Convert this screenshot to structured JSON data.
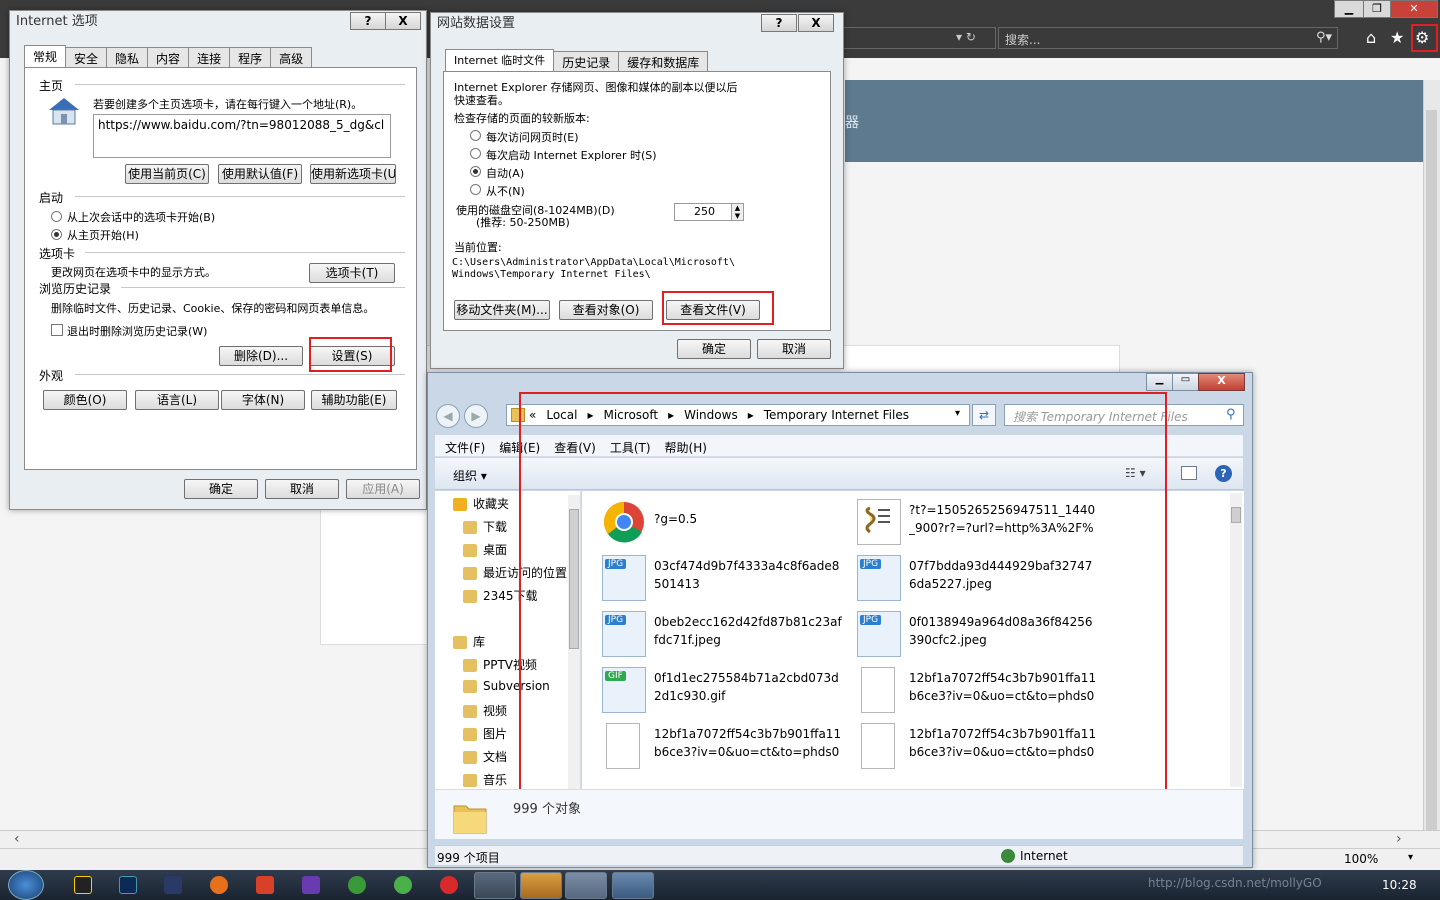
{
  "ie": {
    "search_placeholder": "搜索...",
    "banner_text": "器",
    "zoom": "100%",
    "clock": "10:28",
    "watermark": "http://blog.csdn.net/mollyGO",
    "accent_red": "#e02020"
  },
  "internet_options": {
    "title": "Internet 选项",
    "help": "?",
    "close": "X",
    "tabs": [
      "常规",
      "安全",
      "隐私",
      "内容",
      "连接",
      "程序",
      "高级"
    ],
    "homepage_section": "主页",
    "homepage_hint": "若要创建多个主页选项卡，请在每行键入一个地址(R)。",
    "homepage_url": "https://www.baidu.com/?tn=98012088_5_dg&cl",
    "btn_current": "使用当前页(C)",
    "btn_default": "使用默认值(F)",
    "btn_newtab": "使用新选项卡(U)",
    "startup_section": "启动",
    "startup_opt1": "从上次会话中的选项卡开始(B)",
    "startup_opt2": "从主页开始(H)",
    "tabs_section": "选项卡",
    "tabs_hint": "更改网页在选项卡中的显示方式。",
    "btn_tabs": "选项卡(T)",
    "history_section": "浏览历史记录",
    "history_hint": "删除临时文件、历史记录、Cookie、保存的密码和网页表单信息。",
    "history_check": "退出时删除浏览历史记录(W)",
    "btn_delete": "删除(D)...",
    "btn_settings": "设置(S)",
    "appearance_section": "外观",
    "btn_colors": "颜色(O)",
    "btn_languages": "语言(L)",
    "btn_fonts": "字体(N)",
    "btn_access": "辅助功能(E)",
    "btn_ok": "确定",
    "btn_cancel": "取消",
    "btn_apply": "应用(A)"
  },
  "site_data": {
    "title": "网站数据设置",
    "help": "?",
    "close": "X",
    "tabs": [
      "Internet 临时文件",
      "历史记录",
      "缓存和数据库"
    ],
    "desc1": "Internet Explorer 存储网页、图像和媒体的副本以便以后",
    "desc2": "快速查看。",
    "check_label": "检查存储的页面的较新版本:",
    "opt1": "每次访问网页时(E)",
    "opt2": "每次启动 Internet Explorer 时(S)",
    "opt3": "自动(A)",
    "opt4": "从不(N)",
    "disk_label": "使用的磁盘空间(8-1024MB)(D)",
    "disk_recommend": "(推荐: 50-250MB)",
    "disk_value": "250",
    "location_label": "当前位置:",
    "location_path1": "C:\\Users\\Administrator\\AppData\\Local\\Microsoft\\",
    "location_path2": "Windows\\Temporary Internet Files\\",
    "btn_move": "移动文件夹(M)...",
    "btn_objects": "查看对象(O)",
    "btn_files": "查看文件(V)",
    "btn_ok": "确定",
    "btn_cancel": "取消"
  },
  "explorer": {
    "breadcrumb": [
      "«",
      "Local",
      "Microsoft",
      "Windows",
      "Temporary Internet Files"
    ],
    "search_placeholder": "搜索 Temporary Internet Files",
    "menu": [
      "文件(F)",
      "编辑(E)",
      "查看(V)",
      "工具(T)",
      "帮助(H)"
    ],
    "organize": "组织 ▾",
    "tree": [
      {
        "label": "收藏夹",
        "icon": "star-icon"
      },
      {
        "label": "下载",
        "icon": "download-folder-icon"
      },
      {
        "label": "桌面",
        "icon": "desktop-icon"
      },
      {
        "label": "最近访问的位置",
        "icon": "recent-places-icon"
      },
      {
        "label": "2345下载",
        "icon": "folder-icon"
      },
      {
        "label": "库",
        "icon": "library-icon"
      },
      {
        "label": "PPTV视频",
        "icon": "library-folder-icon"
      },
      {
        "label": "Subversion",
        "icon": "library-folder-icon"
      },
      {
        "label": "视频",
        "icon": "video-library-icon"
      },
      {
        "label": "图片",
        "icon": "pictures-library-icon"
      },
      {
        "label": "文档",
        "icon": "documents-library-icon"
      },
      {
        "label": "音乐",
        "icon": "music-library-icon"
      }
    ],
    "files": [
      {
        "name": "?g=0.5",
        "type": "chrome"
      },
      {
        "name": "?t?=1505265256947511_1440_900?r?=?url?=http%3A%2F%2F...",
        "type": "script"
      },
      {
        "name": "03cf474d9b7f4333a4c8f6ade8501413",
        "type": "jpg"
      },
      {
        "name": "07f7bdda93d444929baf327476da5227.jpeg",
        "type": "jpg"
      },
      {
        "name": "0beb2ecc162d42fd87b81c23affdc71f.jpeg",
        "type": "jpg"
      },
      {
        "name": "0f0138949a964d08a36f84256390cfc2.jpeg",
        "type": "jpg"
      },
      {
        "name": "0f1d1ec275584b71a2cbd073d2d1c930.gif",
        "type": "gif"
      },
      {
        "name": "12bf1a7072ff54c3b7b901ffa11b6ce3?iv=0&uo=ct&to=phds00...",
        "type": "blank"
      },
      {
        "name": "12bf1a7072ff54c3b7b901ffa11b6ce3?iv=0&uo=ct&to=phds00...",
        "type": "blank"
      },
      {
        "name": "12bf1a7072ff54c3b7b901ffa11b6ce3?iv=0&uo=ct&to=phds00...",
        "type": "blank"
      }
    ],
    "count_text": "999 个对象",
    "status_left": "999 个项目",
    "status_zone": "Internet"
  }
}
